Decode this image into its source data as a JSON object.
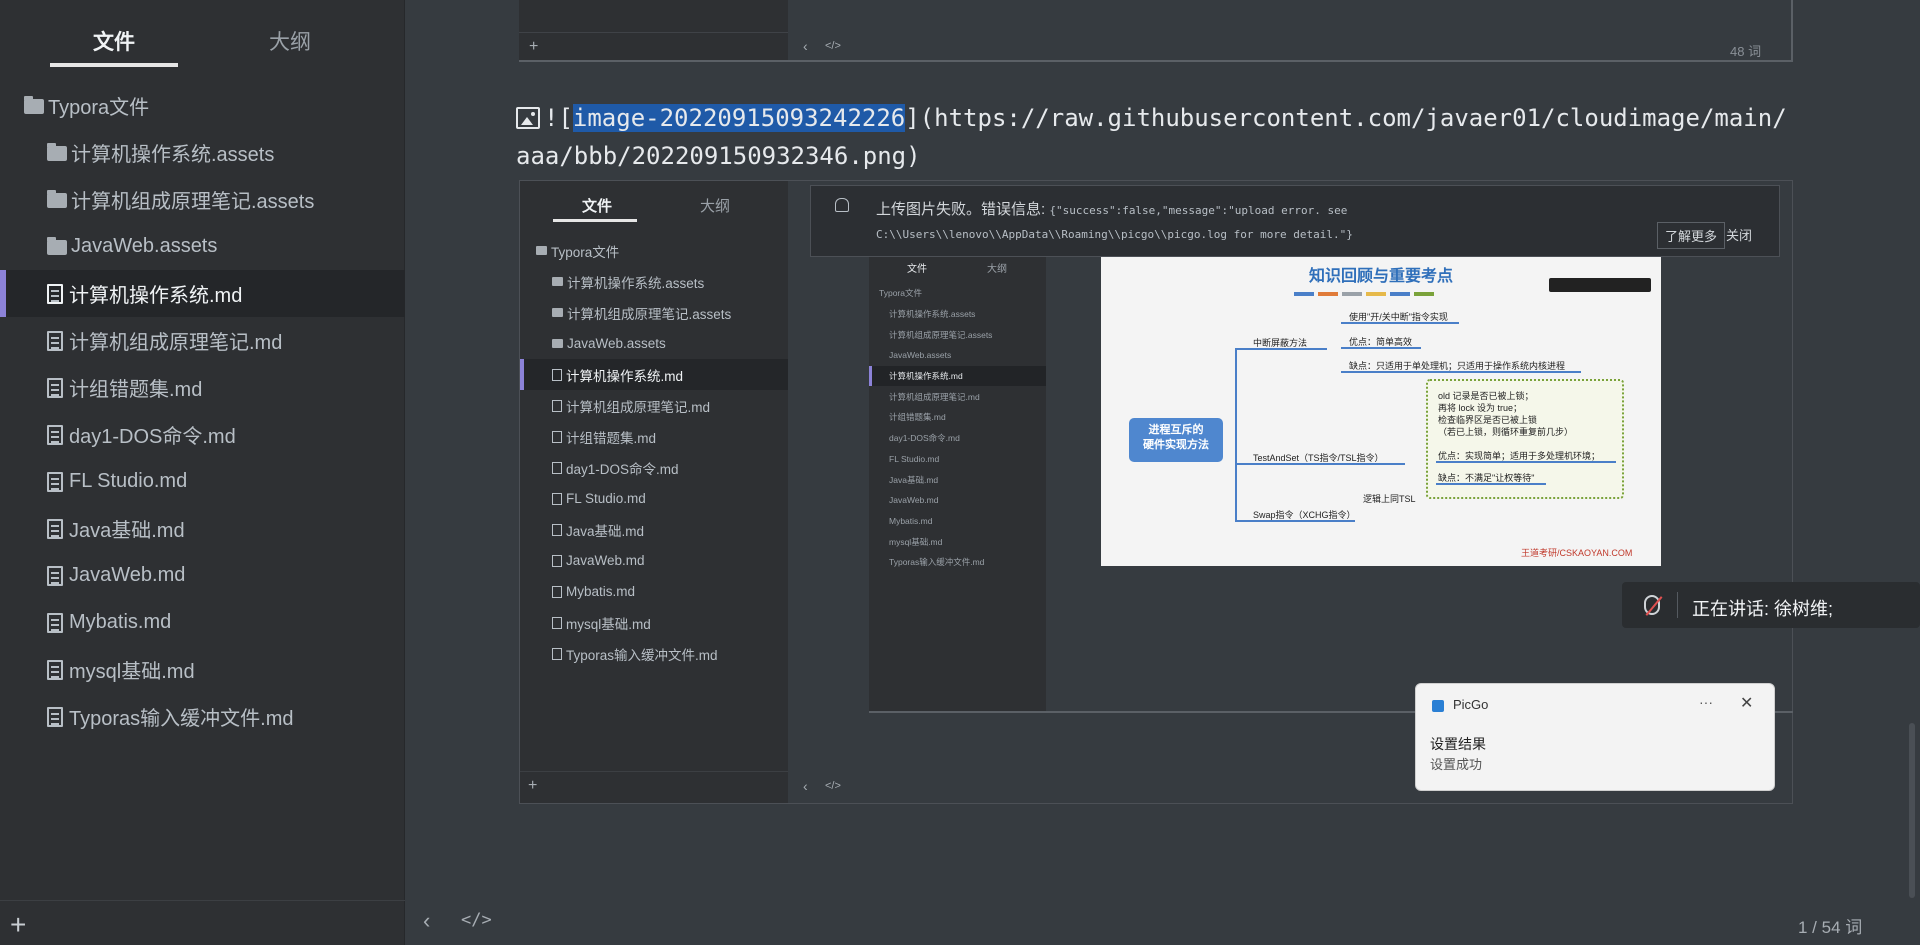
{
  "sidebar": {
    "tabs": [
      "文件",
      "大纲"
    ],
    "root": "Typora文件",
    "items": [
      {
        "label": "计算机操作系统.assets",
        "type": "folder"
      },
      {
        "label": "计算机组成原理笔记.assets",
        "type": "folder"
      },
      {
        "label": "JavaWeb.assets",
        "type": "folder"
      },
      {
        "label": "计算机操作系统.md",
        "type": "file"
      },
      {
        "label": "计算机组成原理笔记.md",
        "type": "file"
      },
      {
        "label": "计组错题集.md",
        "type": "file"
      },
      {
        "label": "day1-DOS命令.md",
        "type": "file"
      },
      {
        "label": "FL Studio.md",
        "type": "file"
      },
      {
        "label": "Java基础.md",
        "type": "file"
      },
      {
        "label": "JavaWeb.md",
        "type": "file"
      },
      {
        "label": "Mybatis.md",
        "type": "file"
      },
      {
        "label": "mysql基础.md",
        "type": "file"
      },
      {
        "label": "Typoras输入缓冲文件.md",
        "type": "file"
      }
    ],
    "add_label": "+"
  },
  "editor": {
    "top_shot_count": "48 词",
    "md_line1_prefix": "![",
    "md_line1_selected": "image-20220915093242226",
    "md_line1_suffix": "](https://raw.githubusercontent.com/javaer01/cloudimage/main/",
    "md_line2": "aaa/bbb/202209150932346.png)",
    "footer_count": "1 / 54 词"
  },
  "screenshot": {
    "tabs": [
      "文件",
      "大纲"
    ],
    "root": "Typora文件",
    "items": [
      "计算机操作系统.assets",
      "计算机组成原理笔记.assets",
      "JavaWeb.assets",
      "计算机操作系统.md",
      "计算机组成原理笔记.md",
      "计组错题集.md",
      "day1-DOS命令.md",
      "FL Studio.md",
      "Java基础.md",
      "JavaWeb.md",
      "Mybatis.md",
      "mysql基础.md",
      "Typoras输入缓冲文件.md"
    ],
    "notification": {
      "title": "上传图片失败。错误信息:",
      "line1": "{\"success\":false,\"message\":\"upload error. see",
      "line2": "C:\\\\Users\\\\lenovo\\\\AppData\\\\Roaming\\\\picgo\\\\picgo.log for more detail.\"}",
      "more": "了解更多",
      "close": "关闭"
    },
    "slide": {
      "title": "知识回顾与重要考点",
      "center": "进程互斥的\n硬件实现方法",
      "b1": "中断屏蔽方法",
      "b1a": "使用\"开/关中断\"指令实现",
      "b1b": "优点：简单高效",
      "b1c": "缺点：只适用于单处理机；只适用于操作系统内核进程",
      "b2": "TestAndSet（TS指令/TSL指令）",
      "b2a": "old 记录是否已被上锁；",
      "b2b": "再将 lock 设为 true；",
      "b2c": "检查临界区是否已被上锁",
      "b2d": "（若已上锁，则循环重复前几步）",
      "b2e": "优点：实现简单；适用于多处理机环境；",
      "b2f": "缺点：不满足\"让权等待\"",
      "b3": "Swap指令（XCHG指令）",
      "b3note": "逻辑上同TSL",
      "watermark": "王道考研/CSKAOYAN.COM"
    }
  },
  "speaking": {
    "text": "正在讲话: 徐树维;"
  },
  "picgo": {
    "app": "PicGo",
    "title": "设置结果",
    "body": "设置成功",
    "dots": "···",
    "close": "✕"
  }
}
